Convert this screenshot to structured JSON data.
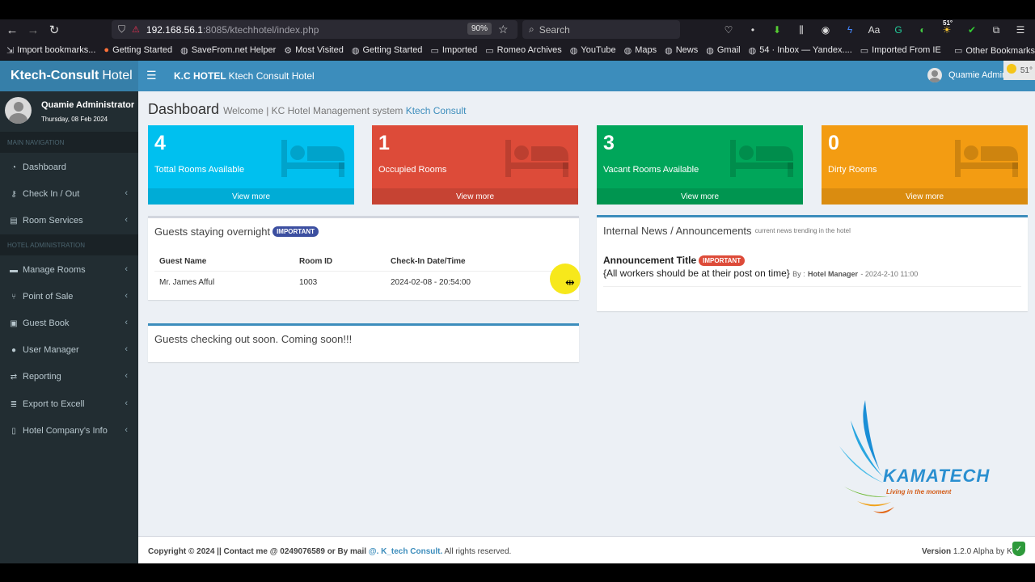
{
  "browser": {
    "url_host": "192.168.56.1",
    "url_path": ":8085/ktechhotel/index.php",
    "zoom": "90%",
    "search_placeholder": "Search",
    "weather_badge": "51°",
    "bookmarks": [
      {
        "label": "Import bookmarks...",
        "icon": "import-icon"
      },
      {
        "label": "Getting Started",
        "icon": "firefox-icon"
      },
      {
        "label": "SaveFrom.net Helper",
        "icon": "globe-icon"
      },
      {
        "label": "Most Visited",
        "icon": "gear-icon"
      },
      {
        "label": "Getting Started",
        "icon": "globe-icon"
      },
      {
        "label": "Imported",
        "icon": "folder-icon"
      },
      {
        "label": "Romeo Archives",
        "icon": "folder-icon"
      },
      {
        "label": "YouTube",
        "icon": "globe-icon"
      },
      {
        "label": "Maps",
        "icon": "globe-icon"
      },
      {
        "label": "News",
        "icon": "globe-icon"
      },
      {
        "label": "Gmail",
        "icon": "globe-icon"
      },
      {
        "label": "54 · Inbox — Yandex....",
        "icon": "globe-icon"
      },
      {
        "label": "Imported From IE",
        "icon": "folder-icon"
      }
    ],
    "other_bookmarks": "Other Bookmarks"
  },
  "header": {
    "brand_bold": "Ktech-Consult",
    "brand_rest": "Hotel",
    "title_bold": "K.C HOTEL",
    "title_rest": "Ktech Consult Hotel",
    "user": "Quamie Admin",
    "weather": "51°"
  },
  "sidebar": {
    "user_name": "Quamie Administrator",
    "date": "Thursday, 08 Feb 2024",
    "main_nav": "MAIN NAVIGATION",
    "hotel_admin": "HOTEL ADMINISTRATION",
    "items": [
      {
        "label": "Dashboard",
        "icon": "dashboard-icon"
      },
      {
        "label": "Check In / Out",
        "icon": "key-icon"
      },
      {
        "label": "Room Services",
        "icon": "book-icon"
      },
      {
        "label": "Manage Rooms",
        "icon": "bed-icon"
      },
      {
        "label": "Point of Sale",
        "icon": "utensils-icon"
      },
      {
        "label": "Guest Book",
        "icon": "briefcase-icon"
      },
      {
        "label": "User Manager",
        "icon": "user-icon"
      },
      {
        "label": "Reporting",
        "icon": "exchange-icon"
      },
      {
        "label": "Export to Excell",
        "icon": "list-icon"
      },
      {
        "label": "Hotel Company's Info",
        "icon": "file-icon"
      }
    ]
  },
  "page": {
    "title": "Dashboard",
    "subtitle": "Welcome | KC Hotel Management system",
    "subtitle_link": "Ktech Consult"
  },
  "stats": [
    {
      "value": "4",
      "label": "Tottal Rooms Available",
      "more": "View more",
      "color": "#00c0ef"
    },
    {
      "value": "1",
      "label": "Occupied Rooms",
      "more": "View more",
      "color": "#dd4b39"
    },
    {
      "value": "3",
      "label": "Vacant Rooms Available",
      "more": "View more",
      "color": "#00a65a"
    },
    {
      "value": "0",
      "label": "Dirty Rooms",
      "more": "View more",
      "color": "#f39c12"
    }
  ],
  "guests": {
    "title": "Guests staying overnight",
    "badge": "IMPORTANT",
    "columns": [
      "Guest Name",
      "Room ID",
      "Check-In Date/Time"
    ],
    "rows": [
      [
        "Mr. James Afful",
        "1003",
        "2024-02-08 - 20:54:00"
      ]
    ]
  },
  "checkout": {
    "title": "Guests checking out soon. Coming soon!!!"
  },
  "news": {
    "title": "Internal News / Announcements",
    "subtitle": "current news trending in the hotel",
    "ann_title": "Announcement Title",
    "ann_badge": "IMPORTANT",
    "ann_body": "{All workers should be at their post on time}",
    "by_label": "By :",
    "by_author": "Hotel Manager",
    "by_date": "- 2024-2-10 11:00"
  },
  "footer": {
    "copyright": "Copyright © 2024 || Contact me @ 0249076589 or By mail",
    "link": "@. K_tech Consult.",
    "rights": "All rights reserved.",
    "version_label": "Version",
    "version": "1.2.0 Alpha by K"
  },
  "logo": {
    "name": "KAMATECH",
    "tagline": "Living in the moment"
  }
}
